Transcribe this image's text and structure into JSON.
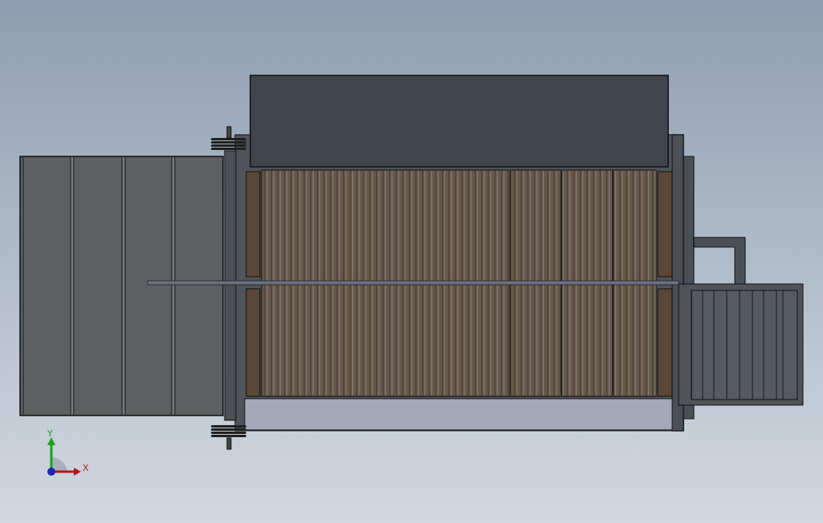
{
  "viewport": {
    "triad": {
      "y_label": "Y",
      "x_label": "X"
    }
  }
}
